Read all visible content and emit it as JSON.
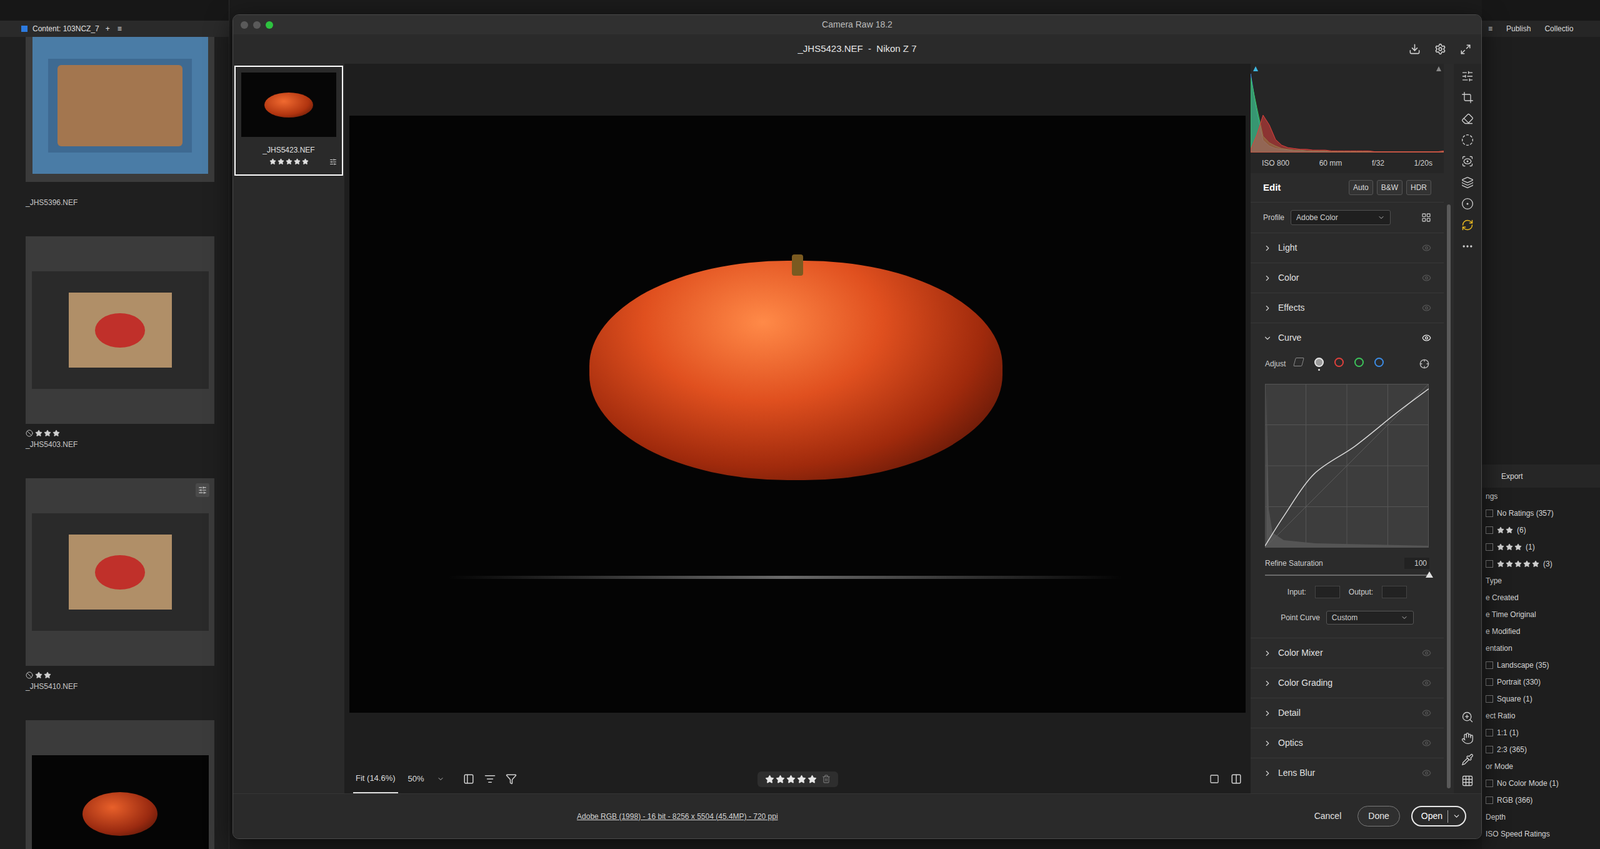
{
  "bridge": {
    "content_panel": {
      "title": "Content: 103NCZ_7",
      "add": "+",
      "menu": "≡",
      "thumbnails": [
        {
          "name": "_JHS5396.NEF",
          "kind": "chart",
          "stars": 0,
          "rejected": false,
          "edited": false
        },
        {
          "name": "_JHS5403.NEF",
          "kind": "board",
          "stars": 3,
          "rejected": true,
          "edited": false
        },
        {
          "name": "_JHS5410.NEF",
          "kind": "board",
          "stars": 2,
          "rejected": true,
          "edited": true
        },
        {
          "kind": "tomato",
          "stars": 0,
          "rejected": false,
          "edited": false
        }
      ]
    },
    "right_panel": {
      "menu": "≡",
      "tabs": [
        {
          "label": "Publish",
          "selected": false
        },
        {
          "label": "Collectio",
          "selected": false
        }
      ],
      "export": "Export",
      "filters": [
        {
          "label": "ngs",
          "kind": "heading"
        },
        {
          "label": "No Ratings (357)",
          "kind": "check",
          "checked": false
        },
        {
          "label": "(6)",
          "kind": "stars",
          "stars": 2,
          "checked": false
        },
        {
          "label": "(1)",
          "kind": "stars",
          "stars": 3,
          "checked": false
        },
        {
          "label": "(3)",
          "kind": "stars",
          "stars": 5,
          "checked": false
        },
        {
          "label": "Type",
          "kind": "heading"
        },
        {
          "label": "e Created",
          "kind": "heading"
        },
        {
          "label": "e Time Original",
          "kind": "heading"
        },
        {
          "label": "e Modified",
          "kind": "heading"
        },
        {
          "label": "entation",
          "kind": "heading"
        },
        {
          "label": "Landscape (35)",
          "kind": "check",
          "checked": false
        },
        {
          "label": "Portrait (330)",
          "kind": "check",
          "checked": false
        },
        {
          "label": "Square (1)",
          "kind": "check",
          "checked": false
        },
        {
          "label": "ect Ratio",
          "kind": "heading"
        },
        {
          "label": "1:1 (1)",
          "kind": "check",
          "checked": false
        },
        {
          "label": "2:3 (365)",
          "kind": "check",
          "checked": false
        },
        {
          "label": "or Mode",
          "kind": "heading"
        },
        {
          "label": "No Color Mode (1)",
          "kind": "check",
          "checked": false
        },
        {
          "label": "RGB (366)",
          "kind": "check",
          "checked": false
        },
        {
          "label": "Depth",
          "kind": "heading"
        },
        {
          "label": "ISO Speed Ratings",
          "kind": "heading"
        }
      ]
    }
  },
  "camera_raw": {
    "title": "Camera Raw 18.2",
    "file_title": "_JHS5423.NEF  -  Nikon Z 7",
    "filmstrip": [
      {
        "name": "_JHS5423.NEF",
        "stars": 5,
        "selected": true,
        "edited": true
      }
    ],
    "histogram": {
      "red": [
        0.04,
        0.22,
        0.46,
        0.34,
        0.16,
        0.09,
        0.06,
        0.05,
        0.04,
        0.04,
        0.03,
        0.03,
        0.03,
        0.02,
        0.02,
        0.02,
        0.02,
        0.02,
        0.02,
        0.02,
        0.01,
        0.01,
        0.01,
        0.01,
        0.01,
        0.01,
        0.01,
        0.01,
        0.01,
        0.01,
        0.01,
        0.02
      ],
      "green": [
        0.92,
        0.55,
        0.2,
        0.12,
        0.08,
        0.05,
        0.04,
        0.03,
        0.03,
        0.02,
        0.02,
        0.02,
        0.02,
        0.01,
        0.01,
        0.01,
        0.01,
        0.01,
        0.01,
        0.01,
        0.01,
        0.01,
        0.01,
        0.01,
        0.01,
        0.01,
        0.01,
        0.01,
        0.01,
        0.01,
        0.01,
        0.01
      ],
      "blue": [
        0.97,
        0.5,
        0.15,
        0.08,
        0.05,
        0.04,
        0.03,
        0.02,
        0.02,
        0.02,
        0.01,
        0.01,
        0.01,
        0.01,
        0.01,
        0.01,
        0.01,
        0.01,
        0.01,
        0.01,
        0.01,
        0.01,
        0.01,
        0.01,
        0.01,
        0.01,
        0.01,
        0.01,
        0.01,
        0.01,
        0.01,
        0.01
      ]
    },
    "exif": [
      "ISO 800",
      "60 mm",
      "f/32",
      "1/20s"
    ],
    "edit": {
      "title": "Edit",
      "buttons": [
        "Auto",
        "B&W",
        "HDR"
      ]
    },
    "profile": {
      "label": "Profile",
      "value": "Adobe Color"
    },
    "panels": [
      {
        "label": "Light",
        "expanded": false,
        "eye_active": false
      },
      {
        "label": "Color",
        "expanded": false,
        "eye_active": false
      },
      {
        "label": "Effects",
        "expanded": false,
        "eye_active": false
      },
      {
        "label": "Curve",
        "expanded": true,
        "eye_active": true
      },
      {
        "label": "Color Mixer",
        "expanded": false,
        "eye_active": false
      },
      {
        "label": "Color Grading",
        "expanded": false,
        "eye_active": false
      },
      {
        "label": "Detail",
        "expanded": false,
        "eye_active": false
      },
      {
        "label": "Optics",
        "expanded": false,
        "eye_active": false
      },
      {
        "label": "Lens Blur",
        "expanded": false,
        "eye_active": false
      }
    ],
    "curve": {
      "adjust_label": "Adjust",
      "channels": [
        {
          "kind": "parametric",
          "selected": false,
          "color": "#8a8a8a"
        },
        {
          "kind": "point",
          "selected": true,
          "color": "#e8e8e8"
        },
        {
          "kind": "channel",
          "selected": false,
          "color": "#e0403c"
        },
        {
          "kind": "channel",
          "selected": false,
          "color": "#3cc45a"
        },
        {
          "kind": "channel",
          "selected": false,
          "color": "#3c8ce6"
        }
      ],
      "points": [
        [
          0,
          0.01
        ],
        [
          0.12,
          0.2
        ],
        [
          0.3,
          0.45
        ],
        [
          0.55,
          0.62
        ],
        [
          0.8,
          0.82
        ],
        [
          1,
          0.97
        ]
      ],
      "refine_label": "Refine Saturation",
      "refine_value": "100",
      "refine_level": 1,
      "input_label": "Input:",
      "output_label": "Output:",
      "point_curve_label": "Point Curve",
      "point_curve": "Custom"
    },
    "preview_toolbar": {
      "fit": "Fit (14.6%)",
      "fit_selected": true,
      "zoom": "50%",
      "stars": 5
    },
    "footer": {
      "info": "Adobe RGB (1998) - 16 bit - 8256 x 5504 (45.4MP) - 720 ppi",
      "buttons": [
        {
          "label": "Cancel",
          "kind": "text"
        },
        {
          "label": "Done",
          "kind": "outline"
        },
        {
          "label": "Open",
          "kind": "split"
        }
      ]
    }
  }
}
